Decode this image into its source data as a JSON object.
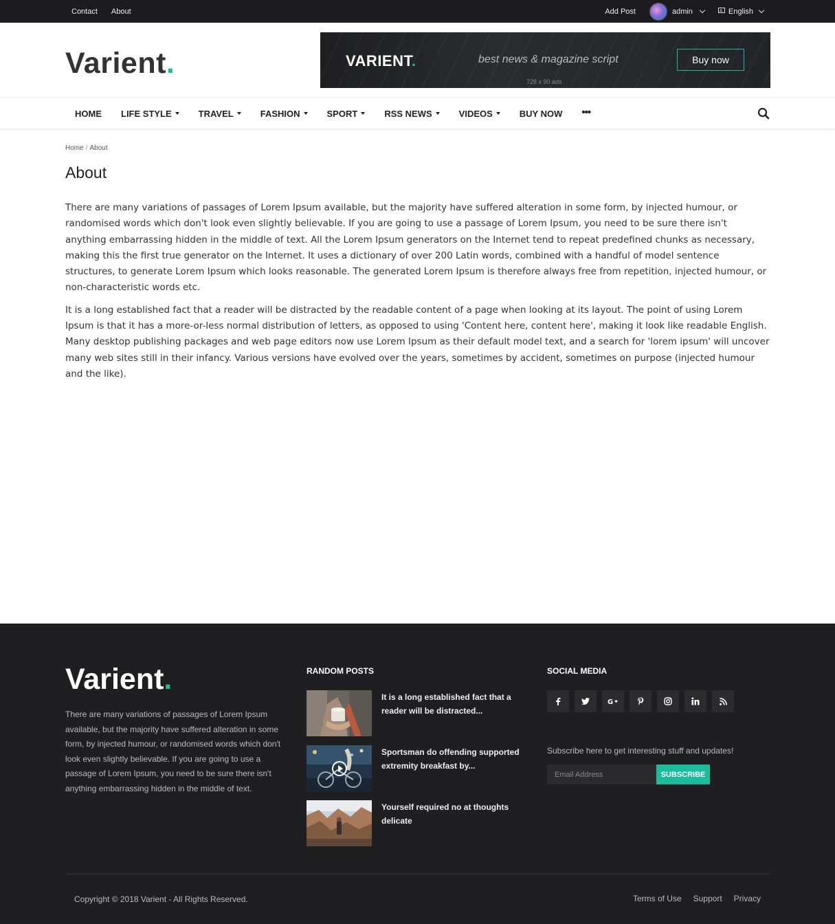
{
  "topbar": {
    "links": [
      "Contact",
      "About"
    ],
    "add_post": "Add Post",
    "user": "admin",
    "language": "English"
  },
  "header": {
    "logo_text": "Varient",
    "logo_dot": ".",
    "ad": {
      "brand": "VARIENT",
      "brand_dot": ".",
      "tagline": "best news & magazine script",
      "button": "Buy now",
      "size_label": "728 x 90 ads"
    }
  },
  "nav": {
    "items": [
      {
        "label": "HOME",
        "dropdown": false
      },
      {
        "label": "LIFE STYLE",
        "dropdown": true
      },
      {
        "label": "TRAVEL",
        "dropdown": true
      },
      {
        "label": "FASHION",
        "dropdown": true
      },
      {
        "label": "SPORT",
        "dropdown": true
      },
      {
        "label": "RSS NEWS",
        "dropdown": true
      },
      {
        "label": "VIDEOS",
        "dropdown": true
      },
      {
        "label": "BUY NOW",
        "dropdown": false
      }
    ],
    "more": "•••"
  },
  "breadcrumb": {
    "home": "Home",
    "separator": "/",
    "current": "About"
  },
  "page": {
    "title": "About",
    "paragraphs": [
      "There are many variations of passages of Lorem Ipsum available, but the majority have suffered alteration in some form, by injected humour, or randomised words which don't look even slightly believable. If you are going to use a passage of Lorem Ipsum, you need to be sure there isn't anything embarrassing hidden in the middle of text. All the Lorem Ipsum generators on the Internet tend to repeat predefined chunks as necessary, making this the first true generator on the Internet. It uses a dictionary of over 200 Latin words, combined with a handful of model sentence structures, to generate Lorem Ipsum which looks reasonable. The generated Lorem Ipsum is therefore always free from repetition, injected humour, or non-characteristic words etc.",
      "It is a long established fact that a reader will be distracted by the readable content of a page when looking at its layout. The point of using Lorem Ipsum is that it has a more-or-less normal distribution of letters, as opposed to using 'Content here, content here', making it look like readable English. Many desktop publishing packages and web page editors now use Lorem Ipsum as their default model text, and a search for 'lorem ipsum' will uncover many web sites still in their infancy. Various versions have evolved over the years, sometimes by accident, sometimes on purpose (injected humour and the like)."
    ]
  },
  "footer": {
    "logo_text": "Varient",
    "logo_dot": ".",
    "about": "There are many variations of passages of Lorem Ipsum available, but the majority have suffered alteration in some form, by injected humour, or randomised words which don't look even slightly believable. If you are going to use a passage of Lorem Ipsum, you need to be sure there isn't anything embarrassing hidden in the middle of text.",
    "random_posts": {
      "heading": "RANDOM POSTS",
      "posts": [
        {
          "title": "It is a long established fact that a reader will be distracted..."
        },
        {
          "title": "Sportsman do offending supported extremity breakfast by..."
        },
        {
          "title": "Yourself required no at thoughts delicate"
        }
      ]
    },
    "social": {
      "heading": "SOCIAL MEDIA",
      "icons": [
        "facebook-icon",
        "twitter-icon",
        "google-plus-icon",
        "pinterest-icon",
        "instagram-icon",
        "linkedin-icon",
        "rss-icon"
      ],
      "subscribe_text": "Subscribe here to get interesting stuff and updates!",
      "email_placeholder": "Email Address",
      "subscribe_button": "SUBSCRIBE"
    },
    "copyright": "Copyright © 2018 Varient - All Rights Reserved.",
    "links": [
      "Terms of Use",
      "Support",
      "Privacy"
    ]
  },
  "colors": {
    "accent": "#1abc9c",
    "topbar_bg": "#1c1c1e",
    "footer_bg": "#1f1f21"
  }
}
